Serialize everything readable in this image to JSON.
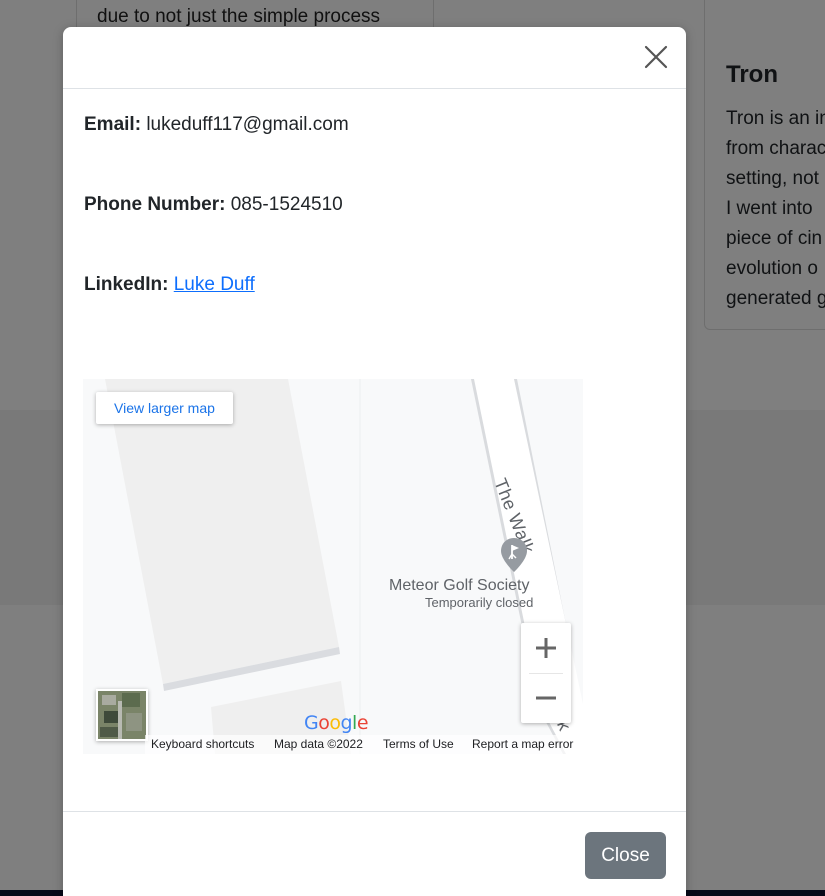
{
  "background": {
    "left_card_text": "due to not just the simple process",
    "right_card": {
      "title": "Tron",
      "lines": [
        "Tron is an in",
        "from charac",
        "setting, not",
        "I went into",
        "piece of cin",
        "evolution o",
        "generated g"
      ]
    }
  },
  "modal": {
    "close_icon": "close-icon",
    "email": {
      "label": "Email:",
      "value": "lukeduff117@gmail.com"
    },
    "phone": {
      "label": "Phone Number:",
      "value": "085-1524510"
    },
    "linkedin": {
      "label": "LinkedIn:",
      "link_text": "Luke Duff"
    },
    "map": {
      "view_larger_label": "View larger map",
      "street_name": "The Walk",
      "street_name_partial": "k",
      "poi_name": "Meteor Golf Society",
      "poi_status": "Temporarily closed",
      "poi_icon": "golf-pin-icon",
      "zoom_in_icon": "plus-icon",
      "zoom_out_icon": "minus-icon",
      "logo": "Google",
      "attribution": {
        "keyboard": "Keyboard shortcuts",
        "map_data": "Map data ©2022",
        "terms": "Terms of Use",
        "report": "Report a map error"
      }
    },
    "footer": {
      "close_label": "Close"
    }
  },
  "colors": {
    "link": "#0d6efd",
    "close_button": "#6c757d",
    "map_link": "#1a73e8"
  }
}
